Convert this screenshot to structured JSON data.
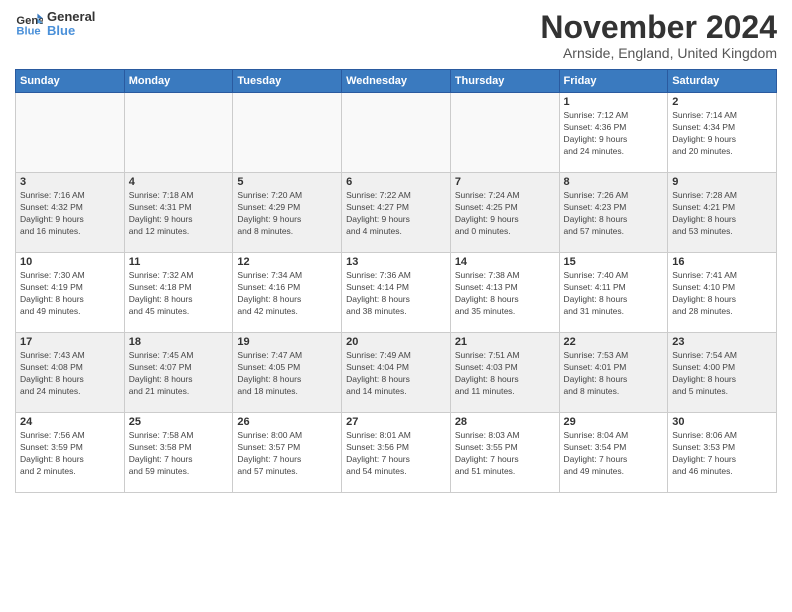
{
  "logo": {
    "line1": "General",
    "line2": "Blue"
  },
  "title": "November 2024",
  "subtitle": "Arnside, England, United Kingdom",
  "weekdays": [
    "Sunday",
    "Monday",
    "Tuesday",
    "Wednesday",
    "Thursday",
    "Friday",
    "Saturday"
  ],
  "weeks": [
    [
      {
        "day": "",
        "info": ""
      },
      {
        "day": "",
        "info": ""
      },
      {
        "day": "",
        "info": ""
      },
      {
        "day": "",
        "info": ""
      },
      {
        "day": "",
        "info": ""
      },
      {
        "day": "1",
        "info": "Sunrise: 7:12 AM\nSunset: 4:36 PM\nDaylight: 9 hours\nand 24 minutes."
      },
      {
        "day": "2",
        "info": "Sunrise: 7:14 AM\nSunset: 4:34 PM\nDaylight: 9 hours\nand 20 minutes."
      }
    ],
    [
      {
        "day": "3",
        "info": "Sunrise: 7:16 AM\nSunset: 4:32 PM\nDaylight: 9 hours\nand 16 minutes."
      },
      {
        "day": "4",
        "info": "Sunrise: 7:18 AM\nSunset: 4:31 PM\nDaylight: 9 hours\nand 12 minutes."
      },
      {
        "day": "5",
        "info": "Sunrise: 7:20 AM\nSunset: 4:29 PM\nDaylight: 9 hours\nand 8 minutes."
      },
      {
        "day": "6",
        "info": "Sunrise: 7:22 AM\nSunset: 4:27 PM\nDaylight: 9 hours\nand 4 minutes."
      },
      {
        "day": "7",
        "info": "Sunrise: 7:24 AM\nSunset: 4:25 PM\nDaylight: 9 hours\nand 0 minutes."
      },
      {
        "day": "8",
        "info": "Sunrise: 7:26 AM\nSunset: 4:23 PM\nDaylight: 8 hours\nand 57 minutes."
      },
      {
        "day": "9",
        "info": "Sunrise: 7:28 AM\nSunset: 4:21 PM\nDaylight: 8 hours\nand 53 minutes."
      }
    ],
    [
      {
        "day": "10",
        "info": "Sunrise: 7:30 AM\nSunset: 4:19 PM\nDaylight: 8 hours\nand 49 minutes."
      },
      {
        "day": "11",
        "info": "Sunrise: 7:32 AM\nSunset: 4:18 PM\nDaylight: 8 hours\nand 45 minutes."
      },
      {
        "day": "12",
        "info": "Sunrise: 7:34 AM\nSunset: 4:16 PM\nDaylight: 8 hours\nand 42 minutes."
      },
      {
        "day": "13",
        "info": "Sunrise: 7:36 AM\nSunset: 4:14 PM\nDaylight: 8 hours\nand 38 minutes."
      },
      {
        "day": "14",
        "info": "Sunrise: 7:38 AM\nSunset: 4:13 PM\nDaylight: 8 hours\nand 35 minutes."
      },
      {
        "day": "15",
        "info": "Sunrise: 7:40 AM\nSunset: 4:11 PM\nDaylight: 8 hours\nand 31 minutes."
      },
      {
        "day": "16",
        "info": "Sunrise: 7:41 AM\nSunset: 4:10 PM\nDaylight: 8 hours\nand 28 minutes."
      }
    ],
    [
      {
        "day": "17",
        "info": "Sunrise: 7:43 AM\nSunset: 4:08 PM\nDaylight: 8 hours\nand 24 minutes."
      },
      {
        "day": "18",
        "info": "Sunrise: 7:45 AM\nSunset: 4:07 PM\nDaylight: 8 hours\nand 21 minutes."
      },
      {
        "day": "19",
        "info": "Sunrise: 7:47 AM\nSunset: 4:05 PM\nDaylight: 8 hours\nand 18 minutes."
      },
      {
        "day": "20",
        "info": "Sunrise: 7:49 AM\nSunset: 4:04 PM\nDaylight: 8 hours\nand 14 minutes."
      },
      {
        "day": "21",
        "info": "Sunrise: 7:51 AM\nSunset: 4:03 PM\nDaylight: 8 hours\nand 11 minutes."
      },
      {
        "day": "22",
        "info": "Sunrise: 7:53 AM\nSunset: 4:01 PM\nDaylight: 8 hours\nand 8 minutes."
      },
      {
        "day": "23",
        "info": "Sunrise: 7:54 AM\nSunset: 4:00 PM\nDaylight: 8 hours\nand 5 minutes."
      }
    ],
    [
      {
        "day": "24",
        "info": "Sunrise: 7:56 AM\nSunset: 3:59 PM\nDaylight: 8 hours\nand 2 minutes."
      },
      {
        "day": "25",
        "info": "Sunrise: 7:58 AM\nSunset: 3:58 PM\nDaylight: 7 hours\nand 59 minutes."
      },
      {
        "day": "26",
        "info": "Sunrise: 8:00 AM\nSunset: 3:57 PM\nDaylight: 7 hours\nand 57 minutes."
      },
      {
        "day": "27",
        "info": "Sunrise: 8:01 AM\nSunset: 3:56 PM\nDaylight: 7 hours\nand 54 minutes."
      },
      {
        "day": "28",
        "info": "Sunrise: 8:03 AM\nSunset: 3:55 PM\nDaylight: 7 hours\nand 51 minutes."
      },
      {
        "day": "29",
        "info": "Sunrise: 8:04 AM\nSunset: 3:54 PM\nDaylight: 7 hours\nand 49 minutes."
      },
      {
        "day": "30",
        "info": "Sunrise: 8:06 AM\nSunset: 3:53 PM\nDaylight: 7 hours\nand 46 minutes."
      }
    ]
  ]
}
